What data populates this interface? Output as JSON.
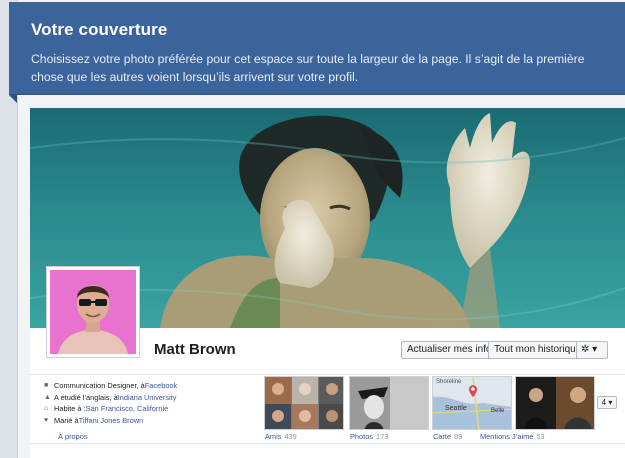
{
  "banner": {
    "title": "Votre couverture",
    "text_line1": "Choisissez votre photo préférée pour cet espace sur toute la largeur de la page. Il s’agit de la première",
    "text_line2": "chose que les autres voient lorsqu’ils arrivent sur votre profil."
  },
  "profile": {
    "name": "Matt Brown",
    "update_info_label": "Actualiser mes infos",
    "history_label": "Tout mon historique",
    "gear_label": "✲ ▾"
  },
  "info": {
    "job_text": "Communication Designer, à ",
    "job_link": "Facebook",
    "study_text": "A étudié l’anglais, à ",
    "study_link": "Indiana University",
    "lives_text": "Habite à : ",
    "lives_link": "San Francisco, Californie",
    "married_text": "Marié à ",
    "married_link": "Tiffani Jones Brown",
    "about_label": "À propos"
  },
  "sections": {
    "friends_label": "Amis",
    "friends_count": "439",
    "photos_label": "Photos",
    "photos_count": "173",
    "map_label": "Carte",
    "map_count": "89",
    "likes_label": "Mentions J’aime",
    "likes_count": "53",
    "more_label": "4 ▾"
  },
  "map_labels": {
    "shoreline": "Shoreline",
    "seattle": "Seattle",
    "bellevue": "Belle"
  },
  "colors": {
    "banner": "#3b649c",
    "link": "#385898",
    "cover_water": "#2a8a8a"
  }
}
